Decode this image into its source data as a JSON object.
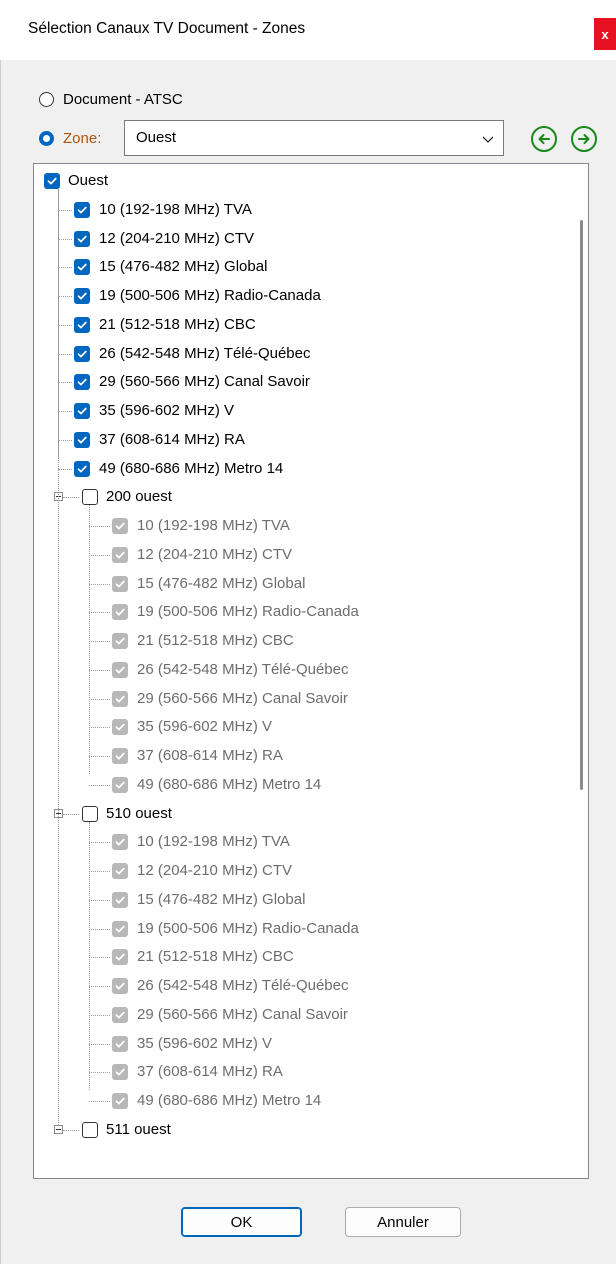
{
  "window": {
    "title": "Sélection Canaux TV Document - Zones",
    "close_label": "x"
  },
  "options": {
    "document_label": "Document - ATSC",
    "zone_label": "Zone:",
    "zone_value": "Ouest"
  },
  "colors": {
    "accent": "#0067c0",
    "zone_label": "#b45309",
    "nav_arrows": "#1a8a1a",
    "close": "#e81123"
  },
  "icons": {
    "prev": "arrow-left-circle-icon",
    "next": "arrow-right-circle-icon",
    "dropdown": "chevron-down-icon"
  },
  "tree": {
    "groups": [
      {
        "name": "Ouest",
        "checked": true,
        "disabled": false,
        "expander": false,
        "channels": [
          "10 (192-198 MHz)  TVA",
          "12 (204-210 MHz)  CTV",
          "15 (476-482 MHz)  Global",
          "19 (500-506 MHz)  Radio-Canada",
          "21 (512-518 MHz)  CBC",
          "26 (542-548 MHz)  Télé-Québec",
          "29 (560-566 MHz)  Canal Savoir",
          "35 (596-602 MHz)  V",
          "37 (608-614 MHz)  RA",
          "49 (680-686 MHz)  Metro 14"
        ]
      },
      {
        "name": "200 ouest",
        "checked": false,
        "disabled": true,
        "expander": true,
        "channels": [
          "10 (192-198 MHz)  TVA",
          "12 (204-210 MHz)  CTV",
          "15 (476-482 MHz)  Global",
          "19 (500-506 MHz)  Radio-Canada",
          "21 (512-518 MHz)  CBC",
          "26 (542-548 MHz)  Télé-Québec",
          "29 (560-566 MHz)  Canal Savoir",
          "35 (596-602 MHz)  V",
          "37 (608-614 MHz)  RA",
          "49 (680-686 MHz)  Metro 14"
        ]
      },
      {
        "name": "510 ouest",
        "checked": false,
        "disabled": true,
        "expander": true,
        "channels": [
          "10 (192-198 MHz)  TVA",
          "12 (204-210 MHz)  CTV",
          "15 (476-482 MHz)  Global",
          "19 (500-506 MHz)  Radio-Canada",
          "21 (512-518 MHz)  CBC",
          "26 (542-548 MHz)  Télé-Québec",
          "29 (560-566 MHz)  Canal Savoir",
          "35 (596-602 MHz)  V",
          "37 (608-614 MHz)  RA",
          "49 (680-686 MHz)  Metro 14"
        ]
      },
      {
        "name": "511 ouest",
        "checked": false,
        "disabled": true,
        "expander": true,
        "channels": []
      }
    ]
  },
  "buttons": {
    "ok": "OK",
    "cancel": "Annuler"
  }
}
